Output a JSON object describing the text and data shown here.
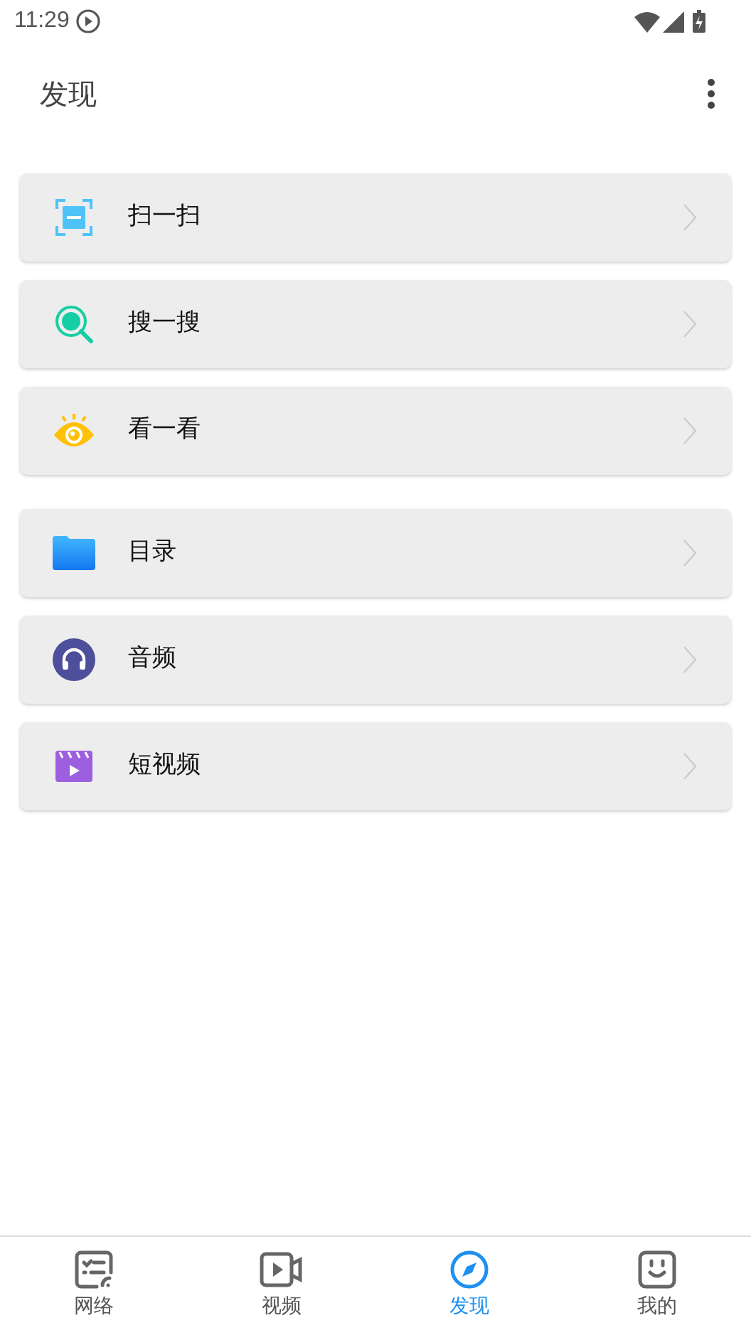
{
  "status_bar": {
    "time": "11:29"
  },
  "app_bar": {
    "title": "发现"
  },
  "groups": [
    {
      "items": [
        {
          "label": "扫一扫",
          "kind": "scan"
        },
        {
          "label": "搜一搜",
          "kind": "search"
        },
        {
          "label": "看一看",
          "kind": "eye"
        }
      ]
    },
    {
      "items": [
        {
          "label": "目录",
          "kind": "folder"
        },
        {
          "label": "音频",
          "kind": "audio"
        },
        {
          "label": "短视频",
          "kind": "video"
        }
      ]
    }
  ],
  "bottom_nav": [
    {
      "label": "网络",
      "kind": "network",
      "selected": false
    },
    {
      "label": "视频",
      "kind": "camera",
      "selected": false
    },
    {
      "label": "发现",
      "kind": "compass",
      "selected": true
    },
    {
      "label": "我的",
      "kind": "face",
      "selected": false
    }
  ]
}
